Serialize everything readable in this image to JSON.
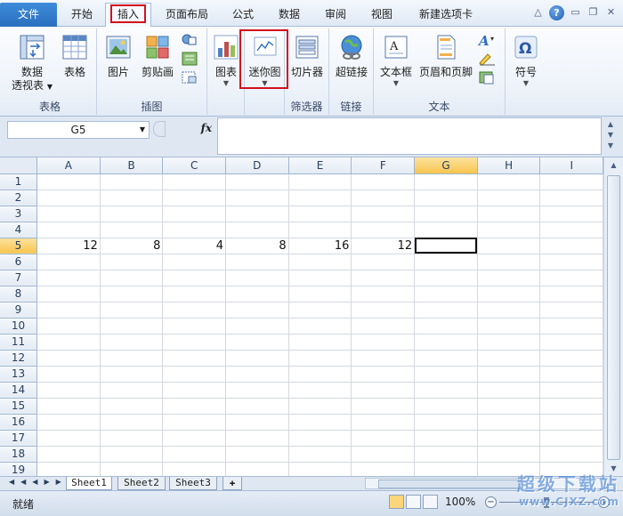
{
  "tabs": {
    "file": "文件",
    "home": "开始",
    "insert": "插入",
    "page_layout": "页面布局",
    "formulas": "公式",
    "data": "数据",
    "review": "审阅",
    "view": "视图",
    "new_tab": "新建选项卡"
  },
  "window_buttons": {
    "help": "?",
    "minimize": "▭",
    "restore": "❐",
    "close": "✕"
  },
  "ribbon": {
    "tables": {
      "pivot_line1": "数据",
      "pivot_line2": "透视表",
      "table": "表格",
      "group": "表格"
    },
    "illustrations": {
      "picture": "图片",
      "clipart": "剪贴画",
      "group": "插图"
    },
    "charts": {
      "chart": "图表"
    },
    "sparklines": {
      "sparkline": "迷你图"
    },
    "filter": {
      "slicer": "切片器",
      "group": "筛选器"
    },
    "links": {
      "hyperlink": "超链接",
      "group": "链接"
    },
    "text": {
      "textbox": "文本框",
      "header_footer": "页眉和页脚",
      "group": "文本"
    },
    "symbols": {
      "symbol": "符号"
    },
    "highlight_color": "#d2111d"
  },
  "formula_bar": {
    "name_box": "G5",
    "fx": "fx",
    "value": ""
  },
  "sheet": {
    "columns": [
      "A",
      "B",
      "C",
      "D",
      "E",
      "F",
      "G",
      "H",
      "I"
    ],
    "rows": [
      "1",
      "2",
      "3",
      "4",
      "5",
      "6",
      "7",
      "8",
      "9",
      "10",
      "11",
      "12",
      "13",
      "14",
      "15",
      "16",
      "17",
      "18",
      "19"
    ],
    "row5_values": [
      "12",
      "8",
      "4",
      "8",
      "16",
      "12",
      "",
      "",
      ""
    ],
    "active_cell": "G5",
    "selected_column": "G",
    "selected_row": "5"
  },
  "sheet_tabs": [
    "Sheet1",
    "Sheet2",
    "Sheet3"
  ],
  "status": {
    "ready": "就绪",
    "zoom": "100%"
  },
  "watermark": {
    "line1": "超级下载站",
    "line2": "www.CJXZ.com"
  }
}
